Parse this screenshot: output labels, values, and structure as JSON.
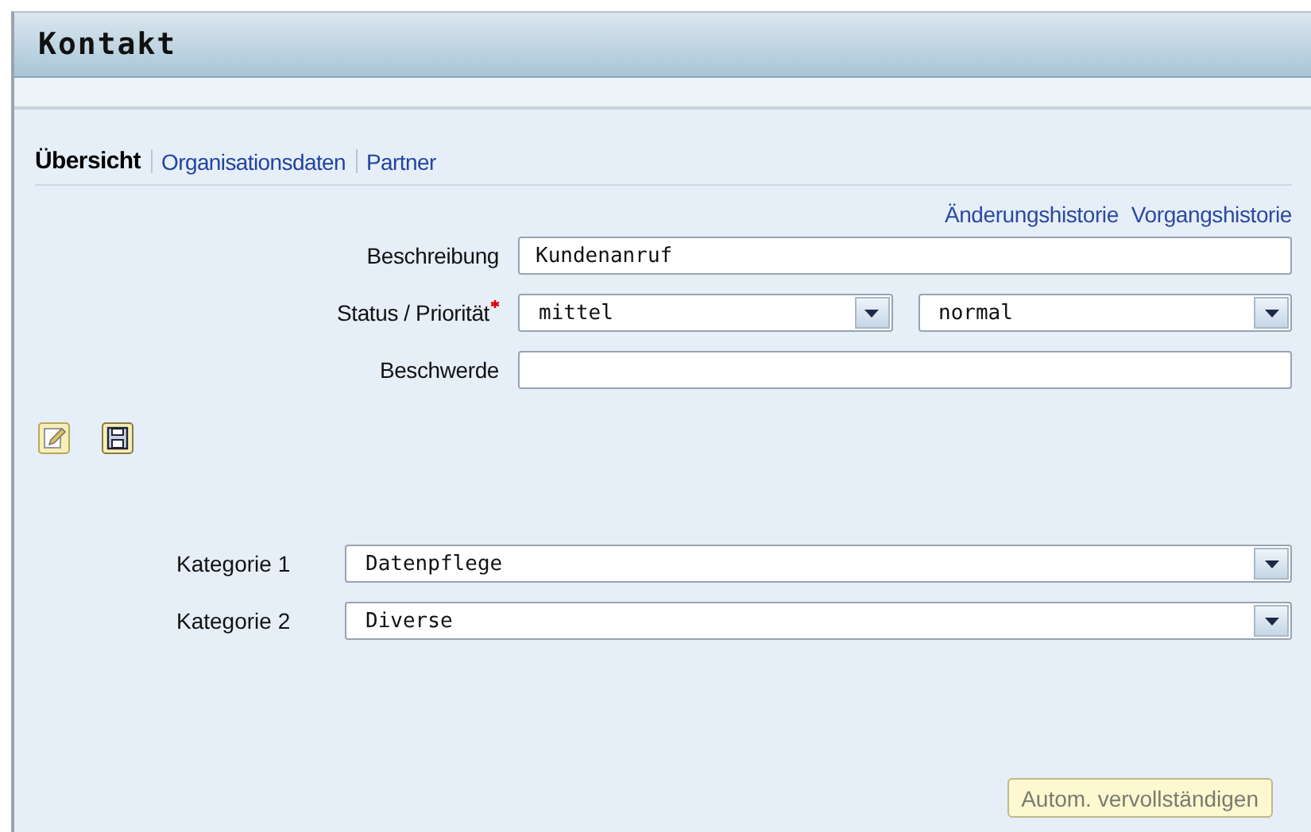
{
  "window": {
    "title": "Kontakt"
  },
  "tabs": [
    {
      "label": "Übersicht",
      "selected": true
    },
    {
      "label": "Organisationsdaten",
      "selected": false
    },
    {
      "label": "Partner",
      "selected": false
    }
  ],
  "links": [
    "Änderungshistorie",
    "Vorgangshistorie"
  ],
  "fields": [
    {
      "label": "Beschreibung",
      "required": false,
      "controls": [
        {
          "kind": "text",
          "value": "Kundenanruf"
        }
      ]
    },
    {
      "label": "Status / Priorität",
      "required": true,
      "controls": [
        {
          "kind": "dropdown",
          "value": "mittel"
        },
        {
          "kind": "dropdown",
          "value": "normal"
        }
      ]
    },
    {
      "label": "Beschwerde",
      "required": false,
      "controls": [
        {
          "kind": "text"
        }
      ]
    }
  ],
  "toolbar": [
    {
      "kind": "edit"
    },
    {
      "kind": "save"
    }
  ],
  "categories": [
    {
      "label": "Kategorie 1",
      "value": "Datenpflege"
    },
    {
      "label": "Kategorie 2",
      "value": "Diverse"
    }
  ],
  "autocomplete_button": {
    "label": "Autom. vervollständigen",
    "disabled": true
  }
}
